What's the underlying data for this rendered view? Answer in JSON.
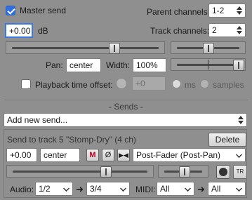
{
  "master": {
    "master_send_label": "Master send",
    "master_send_checked": true,
    "parent_channels_label": "Parent channels:",
    "parent_channels_value": "1-2",
    "volume_value": "+0.00",
    "volume_unit": "dB",
    "track_channels_label": "Track channels:",
    "track_channels_value": "2",
    "pan_label": "Pan:",
    "pan_value": "center",
    "width_label": "Width:",
    "width_value": "100%",
    "playback_offset_label": "Playback time offset:",
    "playback_offset_checked": false,
    "offset_value": "+0",
    "unit_ms": "ms",
    "unit_samples": "samples"
  },
  "sends": {
    "section_title": "- Sends -",
    "add_new_send_label": "Add new send...",
    "send_item": {
      "title": "Send to track 5 \"Stomp-Dry\" (4 ch)",
      "delete_label": "Delete",
      "volume_value": "+0.00",
      "pan_value": "center",
      "mute_label": "M",
      "phase_label": "Ø",
      "mono_label": "▶◀",
      "mode_value": "Post-Fader (Post-Pan)",
      "audio_label": "Audio:",
      "audio_src": "1/2",
      "audio_dst": "3/4",
      "midi_label": "MIDI:",
      "midi_src": "All",
      "midi_dst": "All",
      "arrow_glyph": "➜",
      "env_label": "TR"
    }
  }
}
